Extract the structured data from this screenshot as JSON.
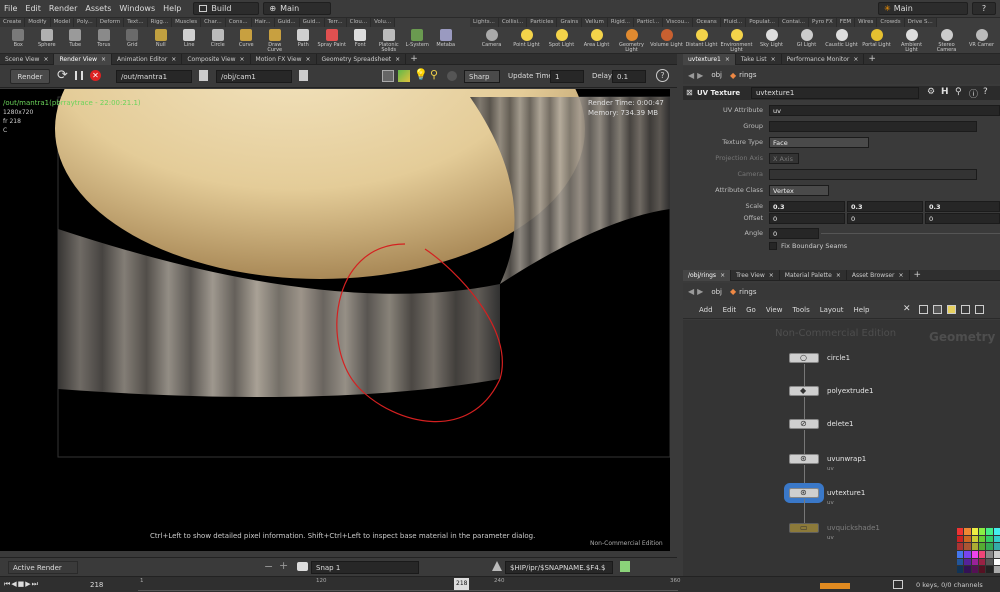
{
  "menubar": {
    "items": [
      "File",
      "Edit",
      "Render",
      "Assets",
      "Windows",
      "Help"
    ],
    "desktop": "Build",
    "context": "Main",
    "right_context": "Main",
    "help_label": "?"
  },
  "shelf": {
    "left_tabs": [
      "Create",
      "Modify",
      "Model",
      "Poly...",
      "Deform",
      "Text...",
      "Rigg...",
      "Muscles",
      "Char...",
      "Cons...",
      "Hair...",
      "Guid...",
      "Guid...",
      "Terr...",
      "Clou...",
      "Volu..."
    ],
    "left_tools": [
      "Box",
      "Sphere",
      "Tube",
      "Torus",
      "Grid",
      "Null",
      "Line",
      "Circle",
      "Curve",
      "Draw Curve",
      "Path",
      "Spray Paint",
      "Font",
      "Platonic Solids",
      "L-System",
      "Metaba"
    ],
    "right_tabs": [
      "Lights...",
      "Collisi...",
      "Particles",
      "Grains",
      "Vellum",
      "Rigid...",
      "Particl...",
      "Viscou...",
      "Oceans",
      "Fluid...",
      "Populat...",
      "Contai...",
      "Pyro FX",
      "FEM",
      "Wires",
      "Crowds",
      "Drive S..."
    ],
    "right_tools": [
      "Camera",
      "Point Light",
      "Spot Light",
      "Area Light",
      "Geometry Light",
      "Volume Light",
      "Distant Light",
      "Environment Light",
      "Sky Light",
      "GI Light",
      "Caustic Light",
      "Portal Light",
      "Ambient Light",
      "Stereo Camera",
      "VR Camer"
    ]
  },
  "left_panetabs": [
    "Scene View",
    "Render View",
    "Animation Editor",
    "Composite View",
    "Motion FX View",
    "Geometry Spreadsheet"
  ],
  "render_toolbar": {
    "render_label": "Render",
    "rop_path": "/out/mantra1",
    "camera_path": "/obj/cam1",
    "sharp_label": "Sharp",
    "update_time_label": "Update Time",
    "update_time_value": "1",
    "delay_label": "Delay",
    "delay_value": "0.1",
    "help_label": "?"
  },
  "viewport": {
    "rop_status": "/out/mantra1(pbrraytrace - 22:00:21.1)",
    "resolution": "1280x720",
    "frame": "fr 218",
    "channel": "C",
    "render_time": "Render Time: 0:00:47",
    "memory": "Memory: 734.39 MB",
    "hint": "Ctrl+Left to show detailed pixel information. Shift+Ctrl+Left to inspect base material in the parameter dialog.",
    "edition": "Non-Commercial Edition"
  },
  "viewport_footer": {
    "active_render": "Active Render",
    "snap_label": "Snap 1",
    "ipr_path": "$HIP/ipr/$SNAPNAME.$F4.$"
  },
  "param_panetabs": [
    "uvtexture1",
    "Take List",
    "Performance Monitor"
  ],
  "params": {
    "path_root": "obj",
    "path_child": "rings",
    "node_type": "UV Texture",
    "node_name": "uvtexture1",
    "rows": [
      {
        "label": "UV Attribute",
        "value": "uv"
      },
      {
        "label": "Group",
        "value": ""
      },
      {
        "label": "Texture Type",
        "value": "Face"
      },
      {
        "label": "Projection Axis",
        "value": "X Axis"
      },
      {
        "label": "Camera",
        "value": ""
      },
      {
        "label": "Attribute Class",
        "value": "Vertex"
      }
    ],
    "scale_label": "Scale",
    "scale": [
      "0.3",
      "0.3",
      "0.3"
    ],
    "offset_label": "Offset",
    "offset": [
      "0",
      "0",
      "0"
    ],
    "angle_label": "Angle",
    "angle": "0",
    "fix_seams": "Fix Boundary Seams"
  },
  "net_panetabs": [
    "/obj/rings",
    "Tree View",
    "Material Palette",
    "Asset Browser"
  ],
  "network": {
    "path_root": "obj",
    "path_child": "rings",
    "menu": [
      "Add",
      "Edit",
      "Go",
      "View",
      "Tools",
      "Layout",
      "Help"
    ],
    "watermark": "Non-Commercial Edition",
    "context_label": "Geometry",
    "nodes": [
      {
        "name": "circle1",
        "sub": ""
      },
      {
        "name": "polyextrude1",
        "sub": ""
      },
      {
        "name": "delete1",
        "sub": ""
      },
      {
        "name": "uvunwrap1",
        "sub": "uv"
      },
      {
        "name": "uvtexture1",
        "sub": "uv"
      },
      {
        "name": "uvquickshade1",
        "sub": "uv"
      }
    ]
  },
  "timeline": {
    "frame": "218",
    "ticks": [
      "1",
      "120",
      "240",
      "360"
    ],
    "current": "218",
    "keys": "0 keys, 0/0 channels"
  },
  "colors": {
    "accent_node": "#3a78c8",
    "annotation": "#d42020",
    "status_green": "#6ad35a"
  }
}
